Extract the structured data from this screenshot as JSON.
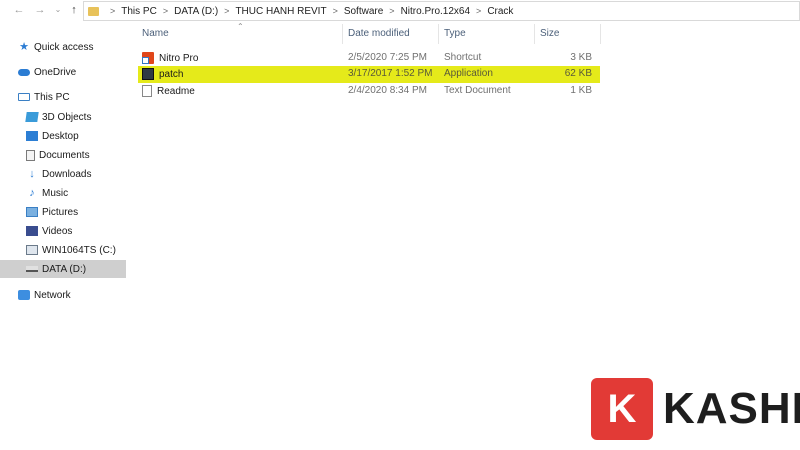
{
  "address_bar": {
    "crumbs": [
      "This PC",
      "DATA (D:)",
      "THUC HANH REVIT",
      "Software",
      "Nitro.Pro.12x64",
      "Crack"
    ]
  },
  "nav_pane": {
    "items": [
      {
        "label": "Quick access",
        "icon": "star-icon"
      },
      {
        "label": "OneDrive",
        "icon": "cloud-icon"
      },
      {
        "label": "This PC",
        "icon": "computer-icon"
      },
      {
        "label": "3D Objects",
        "icon": "cube-icon"
      },
      {
        "label": "Desktop",
        "icon": "desktop-icon"
      },
      {
        "label": "Documents",
        "icon": "document-icon"
      },
      {
        "label": "Downloads",
        "icon": "download-icon"
      },
      {
        "label": "Music",
        "icon": "music-icon"
      },
      {
        "label": "Pictures",
        "icon": "pictures-icon"
      },
      {
        "label": "Videos",
        "icon": "video-icon"
      },
      {
        "label": "WIN1064TS (C:)",
        "icon": "drive-icon"
      },
      {
        "label": "DATA (D:)",
        "icon": "drive-icon",
        "selected": true
      },
      {
        "label": "Network",
        "icon": "network-icon"
      }
    ]
  },
  "file_list": {
    "columns": {
      "name": "Name",
      "date": "Date modified",
      "type": "Type",
      "size": "Size"
    },
    "rows": [
      {
        "name": "Nitro Pro",
        "date": "2/5/2020 7:25 PM",
        "type": "Shortcut",
        "size": "3 KB",
        "icon": "nitro-shortcut-icon"
      },
      {
        "name": "patch",
        "date": "3/17/2017 1:52 PM",
        "type": "Application",
        "size": "62 KB",
        "icon": "application-icon",
        "highlighted": true
      },
      {
        "name": "Readme",
        "date": "2/4/2020 8:34 PM",
        "type": "Text Document",
        "size": "1 KB",
        "icon": "text-file-icon"
      }
    ]
  },
  "colors": {
    "highlight": "#e5ea1a",
    "logo_red": "#e23a36"
  },
  "watermark": {
    "letter": "K",
    "text": "KASHI"
  }
}
